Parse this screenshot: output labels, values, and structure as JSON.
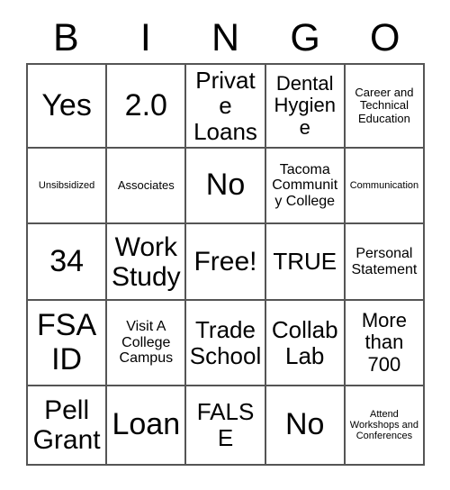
{
  "card": {
    "header": {
      "letters": [
        "B",
        "I",
        "N",
        "G",
        "O"
      ]
    },
    "rows": [
      {
        "cells": [
          {
            "text": "Yes"
          },
          {
            "text": "2.0"
          },
          {
            "text": "Private Loans"
          },
          {
            "text": "Dental Hygiene"
          },
          {
            "text": "Career and Technical Education"
          }
        ]
      },
      {
        "cells": [
          {
            "text": "Unsibsidized"
          },
          {
            "text": "Associates"
          },
          {
            "text": "No"
          },
          {
            "text": "Tacoma Community College"
          },
          {
            "text": "Communication"
          }
        ]
      },
      {
        "cells": [
          {
            "text": "34"
          },
          {
            "text": "Work Study"
          },
          {
            "text": "Free!"
          },
          {
            "text": "TRUE"
          },
          {
            "text": "Personal Statement"
          }
        ]
      },
      {
        "cells": [
          {
            "text": "FSA ID"
          },
          {
            "text": "Visit A College Campus"
          },
          {
            "text": "Trade School"
          },
          {
            "text": "Collab Lab"
          },
          {
            "text": "More than 700"
          }
        ]
      },
      {
        "cells": [
          {
            "text": "Pell Grant"
          },
          {
            "text": "Loan"
          },
          {
            "text": "FALSE"
          },
          {
            "text": "No"
          },
          {
            "text": "Attend Workshops and Conferences"
          }
        ]
      }
    ]
  },
  "colors": {
    "grid_line": "#555555",
    "text": "#000000",
    "background": "#ffffff"
  }
}
